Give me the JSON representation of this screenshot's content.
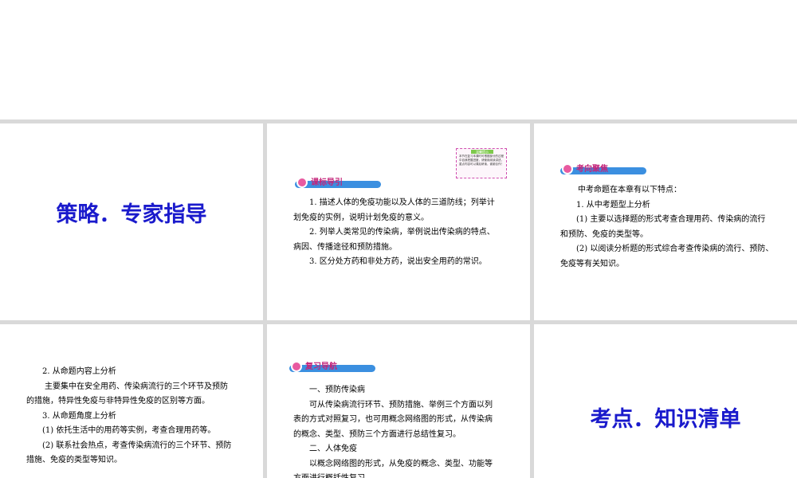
{
  "slides": [
    {
      "title": "策略．专家指导"
    },
    {
      "header": "课标导引",
      "note": {
        "title": "温馨提示",
        "text": "本节在复习本课时可根据部分的过程中自我把握进度，请使用阅读讲述，重点内容可以课后研读，谢谢合作！"
      },
      "lines": [
        "1. 描述人体的免疫功能以及人体的三道防线；列举计",
        "划免疫的实例，说明计划免疫的意义。",
        "2. 列举人类常见的传染病，举例说出传染病的特点、",
        "病因、传播途径和预防措施。",
        "3. 区分处方药和非处方药，说出安全用药的常识。"
      ]
    },
    {
      "header": "考向聚焦",
      "lines": [
        "中考命题在本章有以下特点：",
        "1. 从中考题型上分析",
        "(1) 主要以选择题的形式考查合理用药、传染病的流行",
        "和预防、免疫的类型等。",
        "(2) 以阅读分析题的形式综合考查传染病的流行、预防、",
        "免疫等有关知识。"
      ]
    },
    {
      "lines": [
        "2. 从命题内容上分析",
        "主要集中在安全用药、传染病流行的三个环节及预防",
        "的措施，特异性免疫与非特异性免疫的区别等方面。",
        "3. 从命题角度上分析",
        "(1) 依托生活中的用药等实例，考查合理用药等。",
        "(2) 联系社会热点，考查传染病流行的三个环节、预防",
        "措施、免疫的类型等知识。"
      ]
    },
    {
      "header": "复习导航",
      "lines": [
        "一、预防传染病",
        "可从传染病流行环节、预防措施、举例三个方面以列",
        "表的方式对照复习，也可用概念网络图的形式，从传染病",
        "的概念、类型、预防三个方面进行总结性复习。",
        "二、人体免疫",
        "以概念网络图的形式，从免疫的概念、类型、功能等",
        "方面进行概括性复习。"
      ]
    },
    {
      "title": "考点．知识清单"
    }
  ]
}
